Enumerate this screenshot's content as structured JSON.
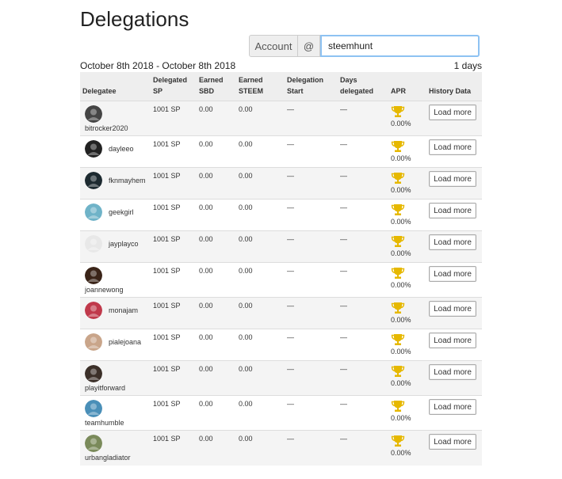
{
  "page_title": "Delegations",
  "account": {
    "label": "Account",
    "at": "@",
    "value": "steemhunt"
  },
  "date_range": "October 8th 2018 - October 8th 2018",
  "days": "1 days",
  "columns": {
    "delegatee": "Delegatee",
    "delegated_sp": [
      "Delegated",
      "SP"
    ],
    "earned_sbd": [
      "Earned",
      "SBD"
    ],
    "earned_steem": [
      "Earned",
      "STEEM"
    ],
    "delegation_start": [
      "Delegation",
      "Start"
    ],
    "days_delegated": [
      "Days",
      "delegated"
    ],
    "apr": "APR",
    "history": "History Data"
  },
  "rows": [
    {
      "name": "bitrocker2020",
      "sp": "1001 SP",
      "sbd": "0.00",
      "steem": "0.00",
      "start": "—",
      "days": "—",
      "apr": "0.00%",
      "btn": "Load more",
      "avatar_color": "#444",
      "stack": true
    },
    {
      "name": "dayleeo",
      "sp": "1001 SP",
      "sbd": "0.00",
      "steem": "0.00",
      "start": "—",
      "days": "—",
      "apr": "0.00%",
      "btn": "Load more",
      "avatar_color": "#222",
      "stack": false
    },
    {
      "name": "fknmayhem",
      "sp": "1001 SP",
      "sbd": "0.00",
      "steem": "0.00",
      "start": "—",
      "days": "—",
      "apr": "0.00%",
      "btn": "Load more",
      "avatar_color": "#1d2a30",
      "stack": false
    },
    {
      "name": "geekgirl",
      "sp": "1001 SP",
      "sbd": "0.00",
      "steem": "0.00",
      "start": "—",
      "days": "—",
      "apr": "0.00%",
      "btn": "Load more",
      "avatar_color": "#6fb3c8",
      "stack": false
    },
    {
      "name": "jayplayco",
      "sp": "1001 SP",
      "sbd": "0.00",
      "steem": "0.00",
      "start": "—",
      "days": "—",
      "apr": "0.00%",
      "btn": "Load more",
      "avatar_color": "#e8e8e8",
      "stack": false
    },
    {
      "name": "joannewong",
      "sp": "1001 SP",
      "sbd": "0.00",
      "steem": "0.00",
      "start": "—",
      "days": "—",
      "apr": "0.00%",
      "btn": "Load more",
      "avatar_color": "#3a2418",
      "stack": true
    },
    {
      "name": "monajam",
      "sp": "1001 SP",
      "sbd": "0.00",
      "steem": "0.00",
      "start": "—",
      "days": "—",
      "apr": "0.00%",
      "btn": "Load more",
      "avatar_color": "#c0394b",
      "stack": false
    },
    {
      "name": "pialejoana",
      "sp": "1001 SP",
      "sbd": "0.00",
      "steem": "0.00",
      "start": "—",
      "days": "—",
      "apr": "0.00%",
      "btn": "Load more",
      "avatar_color": "#c9a58a",
      "stack": false
    },
    {
      "name": "playitforward",
      "sp": "1001 SP",
      "sbd": "0.00",
      "steem": "0.00",
      "start": "—",
      "days": "—",
      "apr": "0.00%",
      "btn": "Load more",
      "avatar_color": "#3b2f28",
      "stack": true
    },
    {
      "name": "teamhumble",
      "sp": "1001 SP",
      "sbd": "0.00",
      "steem": "0.00",
      "start": "—",
      "days": "—",
      "apr": "0.00%",
      "btn": "Load more",
      "avatar_color": "#4a8fb8",
      "stack": true
    },
    {
      "name": "urbangladiator",
      "sp": "1001 SP",
      "sbd": "0.00",
      "steem": "0.00",
      "start": "—",
      "days": "—",
      "apr": "0.00%",
      "btn": "Load more",
      "avatar_color": "#7a8a5a",
      "stack": true
    }
  ],
  "colors": {
    "input_focus_border": "#8ec2f2",
    "trophy": "#e6b800",
    "row_stripe": "#f4f4f4",
    "header_bg": "#eeeeee"
  },
  "icons": {
    "trophy": "trophy-icon",
    "avatar": "avatar"
  }
}
